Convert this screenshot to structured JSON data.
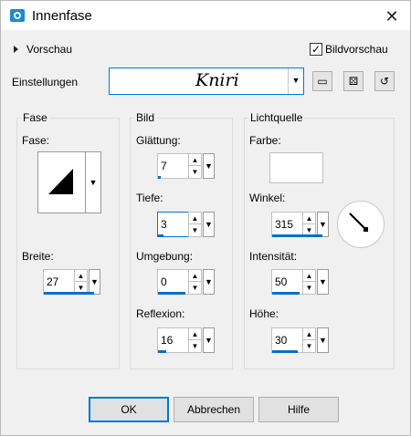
{
  "window": {
    "title": "Innenfase",
    "close_glyph": "✕"
  },
  "preview": {
    "label": "Vorschau",
    "checkbox_label": "Bildvorschau",
    "checked": true
  },
  "settings": {
    "label": "Einstellungen",
    "combo_value": "Kniri"
  },
  "groups": {
    "fase": {
      "title": "Fase",
      "shape_label": "Fase:",
      "breite_label": "Breite:",
      "breite_value": "27"
    },
    "bild": {
      "title": "Bild",
      "glaettung_label": "Glättung:",
      "glaettung_value": "7",
      "tiefe_label": "Tiefe:",
      "tiefe_value": "3",
      "umgebung_label": "Umgebung:",
      "umgebung_value": "0",
      "reflexion_label": "Reflexion:",
      "reflexion_value": "16"
    },
    "licht": {
      "title": "Lichtquelle",
      "farbe_label": "Farbe:",
      "farbe_color": "#ffffff",
      "winkel_label": "Winkel:",
      "winkel_value": "315",
      "intensitaet_label": "Intensität:",
      "intensitaet_value": "50",
      "hoehe_label": "Höhe:",
      "hoehe_value": "30"
    }
  },
  "buttons": {
    "ok": "OK",
    "cancel": "Abbrechen",
    "help": "Hilfe"
  }
}
